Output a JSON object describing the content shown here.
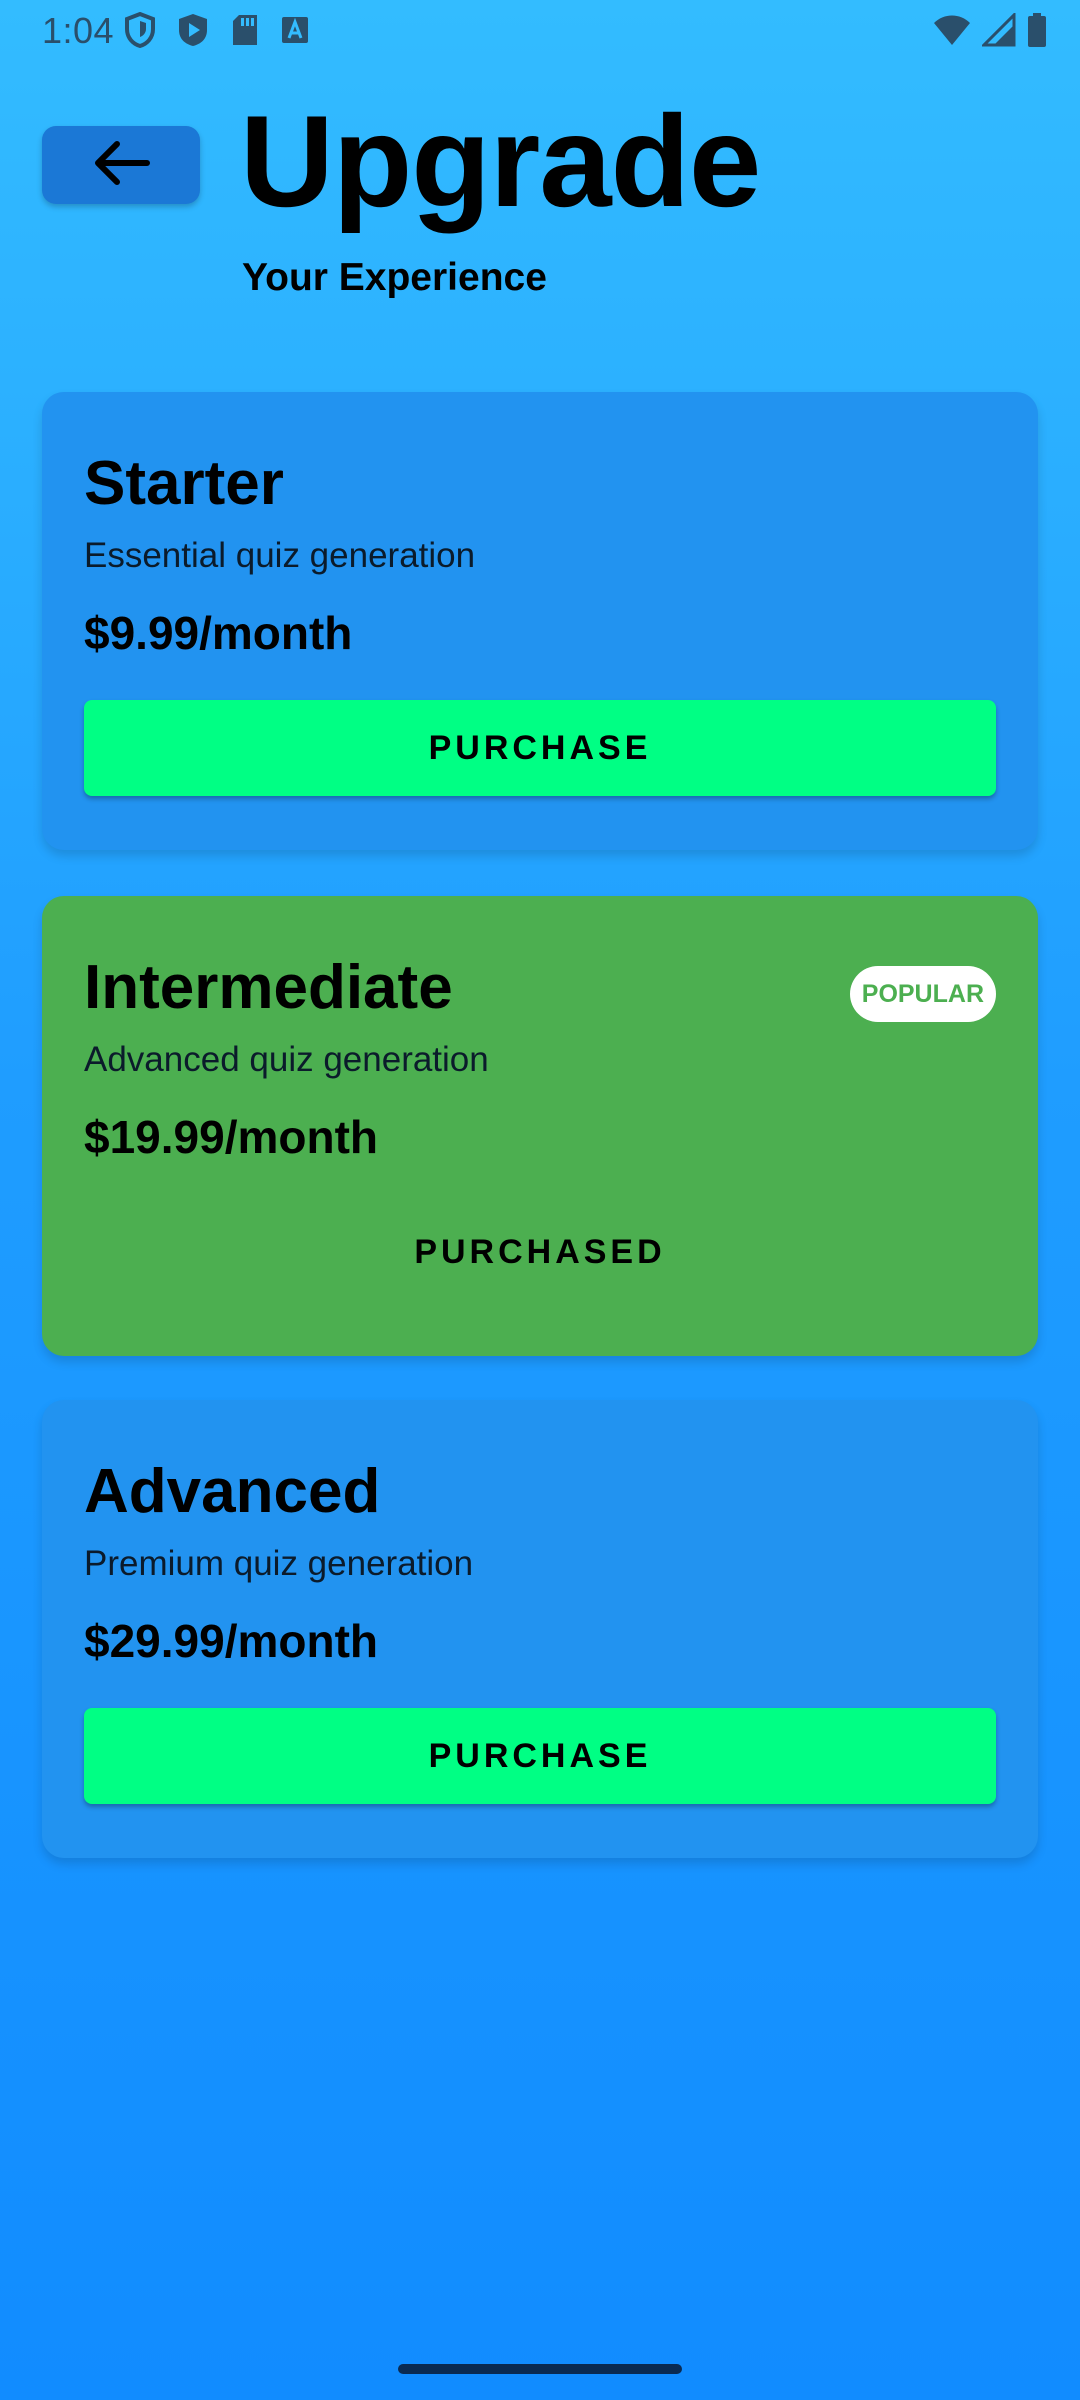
{
  "status_bar": {
    "time": "1:04",
    "left_icons": [
      "shield-icon",
      "play-store-icon",
      "sd-card-icon",
      "font-a-icon"
    ],
    "right_icons": [
      "wifi-icon",
      "cell-signal-icon",
      "battery-icon"
    ]
  },
  "header": {
    "back_icon": "arrow-left-icon",
    "title": "Upgrade",
    "subtitle": "Your Experience"
  },
  "plans": [
    {
      "name": "Starter",
      "description": "Essential quiz generation",
      "price": "$9.99/month",
      "action_label": "PURCHASE",
      "state": "available"
    },
    {
      "name": "Intermediate",
      "description": "Advanced quiz generation",
      "price": "$19.99/month",
      "badge": "POPULAR",
      "action_label": "PURCHASED",
      "state": "purchased"
    },
    {
      "name": "Advanced",
      "description": "Premium quiz generation",
      "price": "$29.99/month",
      "action_label": "PURCHASE",
      "state": "available"
    }
  ],
  "colors": {
    "background_top": "#33bcff",
    "background_bottom": "#118cff",
    "card_blue": "#2293f0",
    "card_green": "#4caf50",
    "purchase_button": "#00ff84",
    "back_button": "#1b78d6"
  }
}
